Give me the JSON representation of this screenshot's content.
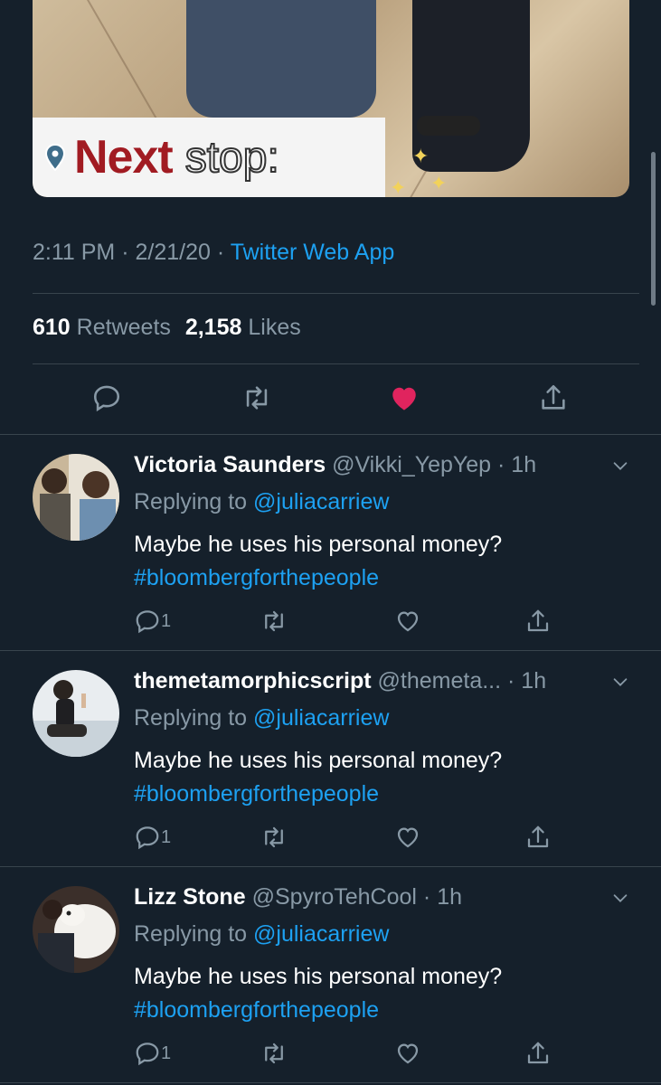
{
  "tweet": {
    "media": {
      "caption_bold": "Next",
      "caption_light": "stop:"
    },
    "time": "2:11 PM",
    "date": "2/21/20",
    "source": "Twitter Web App",
    "retweet_count": "610",
    "retweet_label": "Retweets",
    "like_count": "2,158",
    "like_label": "Likes",
    "liked": true
  },
  "replies": [
    {
      "name": "Victoria Saunders",
      "handle": "@Vikki_YepYep",
      "time": "1h",
      "replying_prefix": "Replying to",
      "replying_to": "@juliacarriew",
      "text": "Maybe he uses his personal money?",
      "hashtag": "#bloombergforthepeople",
      "reply_count": "1"
    },
    {
      "name": "themetamorphicscript",
      "handle": "@themeta...",
      "time": "1h",
      "replying_prefix": "Replying to",
      "replying_to": "@juliacarriew",
      "text": "Maybe he uses his personal money?",
      "hashtag": "#bloombergforthepeople",
      "reply_count": "1"
    },
    {
      "name": "Lizz Stone",
      "handle": "@SpyroTehCool",
      "time": "1h",
      "replying_prefix": "Replying to",
      "replying_to": "@juliacarriew",
      "text": "Maybe he uses his personal money?",
      "hashtag": "#bloombergforthepeople",
      "reply_count": "1"
    }
  ],
  "colors": {
    "background": "#15202b",
    "accent": "#1da1f2",
    "like": "#e0245e",
    "muted": "#8899a6",
    "divider": "#38444d"
  },
  "icons": {
    "reply": "reply-icon",
    "retweet": "retweet-icon",
    "like": "heart-icon",
    "share": "share-icon",
    "more": "chevron-down-icon"
  }
}
